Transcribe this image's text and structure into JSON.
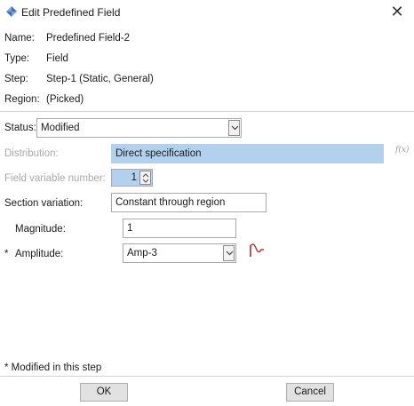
{
  "window": {
    "title": "Edit Predefined Field",
    "icon": "edit-field-icon",
    "close_label": "✕"
  },
  "info": {
    "name_label": "Name:",
    "name_value": "Predefined Field-2",
    "type_label": "Type:",
    "type_value": "Field",
    "step_label": "Step:",
    "step_value": "Step-1 (Static, General)",
    "region_label": "Region:",
    "region_value": "(Picked)"
  },
  "form": {
    "status_label": "Status:",
    "status_value": "Modified",
    "distribution_label": "Distribution:",
    "distribution_value": "Direct specification",
    "fx_label": "f(x)",
    "field_variable_label": "Field variable number:",
    "field_variable_value": "1",
    "section_variation_label": "Section variation:",
    "section_variation_value": "Constant through region",
    "magnitude_label": "Magnitude:",
    "magnitude_value": "1",
    "amplitude_marker": "*",
    "amplitude_label": "Amplitude:",
    "amplitude_value": "Amp-3"
  },
  "footer": {
    "note": "* Modified in this step",
    "ok_label": "OK",
    "cancel_label": "Cancel"
  },
  "colors": {
    "selected_field": "#b3d1ee",
    "disabled_text": "#a8a8a8",
    "amplitude_icon": "#b0303a"
  }
}
